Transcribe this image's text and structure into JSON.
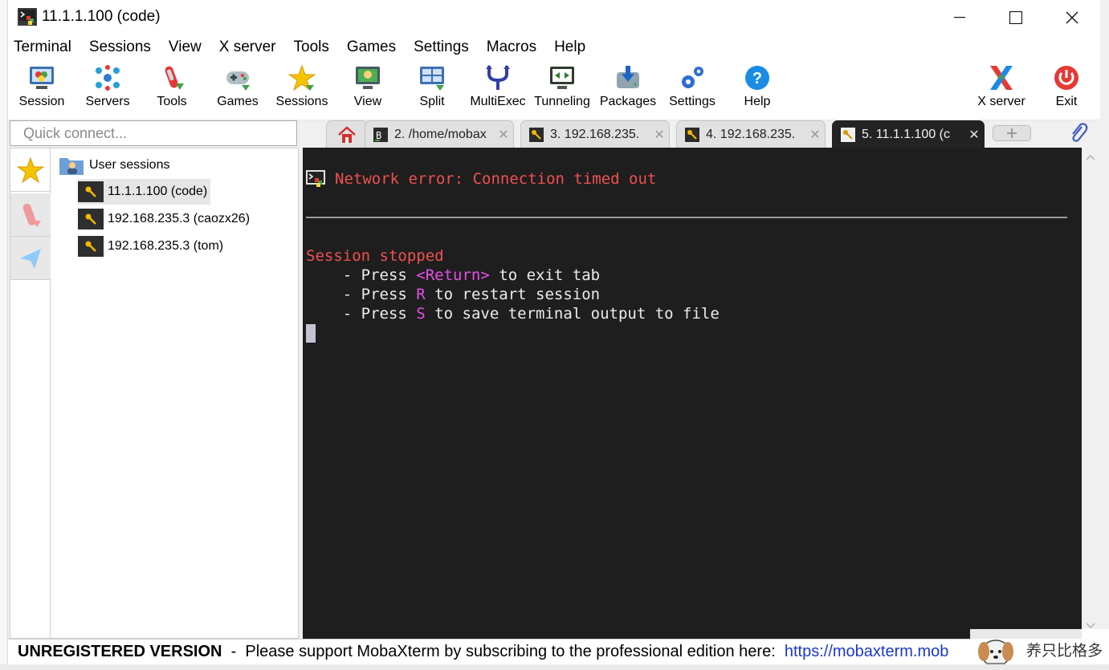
{
  "window": {
    "title": "11.1.1.100 (code)",
    "minimize_glyph": "—",
    "maximize_glyph": "☐",
    "close_glyph": "✕"
  },
  "menu": [
    "Terminal",
    "Sessions",
    "View",
    "X server",
    "Tools",
    "Games",
    "Settings",
    "Macros",
    "Help"
  ],
  "toolbar": {
    "buttons": [
      {
        "label": "Session",
        "icon": "session-icon"
      },
      {
        "label": "Servers",
        "icon": "servers-icon"
      },
      {
        "label": "Tools",
        "icon": "tools-icon"
      },
      {
        "label": "Games",
        "icon": "games-icon"
      },
      {
        "label": "Sessions",
        "icon": "sessions-star-icon"
      },
      {
        "label": "View",
        "icon": "view-icon"
      },
      {
        "label": "Split",
        "icon": "split-icon"
      },
      {
        "label": "MultiExec",
        "icon": "multiexec-icon"
      },
      {
        "label": "Tunneling",
        "icon": "tunneling-icon"
      },
      {
        "label": "Packages",
        "icon": "packages-icon"
      },
      {
        "label": "Settings",
        "icon": "settings-icon"
      },
      {
        "label": "Help",
        "icon": "help-icon"
      }
    ],
    "xserver_label": "X server",
    "exit_label": "Exit"
  },
  "quick_connect": {
    "placeholder": "Quick connect..."
  },
  "tabs": [
    {
      "label": "2. /home/mobax",
      "icon": "bash-icon",
      "active": false
    },
    {
      "label": "3. 192.168.235.",
      "icon": "ssh-key-icon",
      "active": false
    },
    {
      "label": "4. 192.168.235.",
      "icon": "ssh-key-icon",
      "active": false
    },
    {
      "label": "5. 11.1.1.100 (c",
      "icon": "ssh-key-icon",
      "active": true
    }
  ],
  "tab_close_glyph": "✕",
  "sidebar": {
    "root": "User sessions",
    "sessions": [
      {
        "label": "11.1.1.100 (code)",
        "selected": true
      },
      {
        "label": "192.168.235.3 (caozx26)",
        "selected": false
      },
      {
        "label": "192.168.235.3 (tom)",
        "selected": false
      }
    ]
  },
  "terminal": {
    "error": "Network error: Connection timed out",
    "stopped": "Session stopped",
    "press": "- Press",
    "line1_key": "<Return>",
    "line1_rest": " to exit tab",
    "line2_key": "R",
    "line2_rest": " to restart session",
    "line3_key": "S",
    "line3_rest": " to save terminal output to file",
    "colors": {
      "background": "#1e1e1e",
      "error": "#f05050",
      "key": "#e650e6"
    }
  },
  "statusbar": {
    "bold": "UNREGISTERED VERSION",
    "sep": "  -  ",
    "text": "Please support MobaXterm by subscribing to the professional edition here:  ",
    "link": "https://mobaxterm.mob"
  },
  "watermark": {
    "text": "养只比格多"
  }
}
